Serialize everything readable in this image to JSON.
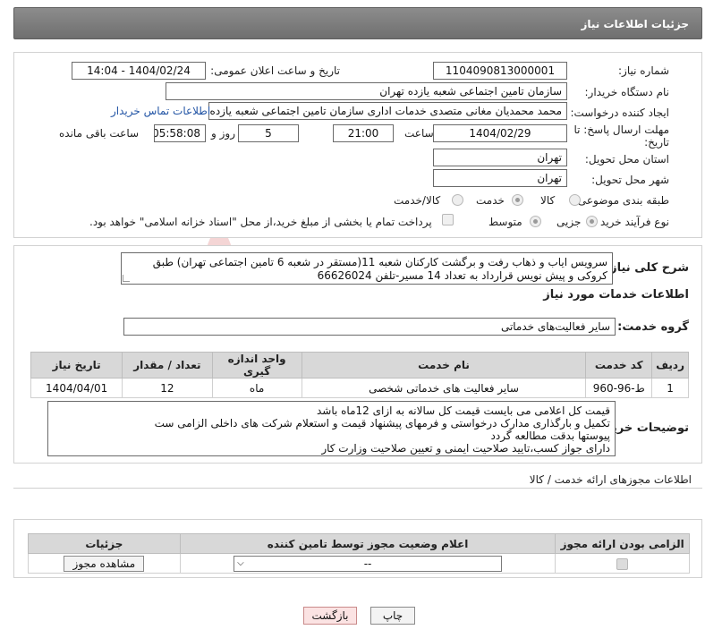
{
  "header": {
    "title": "جزئیات اطلاعات نیاز"
  },
  "form": {
    "need_number_label": "شماره نیاز:",
    "need_number": "1104090813000001",
    "announce_label": "تاریخ و ساعت اعلان عمومی:",
    "announce_value": "1404/02/24 - 14:04",
    "buyer_org_label": "نام دستگاه خریدار:",
    "buyer_org": "سازمان تامین اجتماعی شعبه یازده تهران",
    "creator_label": "ایجاد کننده درخواست:",
    "creator": "محمد محمدیان مغانی متصدی خدمات اداری سازمان تامین اجتماعی شعبه یازده",
    "contact_link": "اطلاعات تماس خریدار",
    "deadline_label": "مهلت ارسال پاسخ: تا تاریخ:",
    "deadline_date": "1404/02/29",
    "time_label": "ساعت",
    "deadline_time": "21:00",
    "days_value": "5",
    "days_label": "روز و",
    "remaining_time": "05:58:08",
    "remaining_label": "ساعت باقی مانده",
    "province_label": "استان محل تحویل:",
    "province": "تهران",
    "city_label": "شهر محل تحویل:",
    "city": "تهران",
    "category_label": "طبقه بندی موضوعی:",
    "category_options": [
      "کالا",
      "خدمت",
      "کالا/خدمت"
    ],
    "category_selected": "خدمت",
    "purchase_type_label": "نوع فرآیند خرید :",
    "purchase_options": [
      "جزیی",
      "متوسط"
    ],
    "purchase_selected": "جزیی",
    "treasury_note": "پرداخت تمام یا بخشی از مبلغ خرید،از محل \"اسناد خزانه اسلامی\" خواهد بود."
  },
  "description": {
    "label": "شرح کلی نیاز:",
    "text": "سرویس ایاب و ذهاب رفت و برگشت کارکنان شعبه 11(مستقر در شعبه 6 تامین اجتماعی تهران) طبق کروکی و پیش نویس قرارداد به تعداد 14 مسیر-تلفن 66626024"
  },
  "services": {
    "section_title": "اطلاعات خدمات مورد نیاز",
    "group_label": "گروه خدمت:",
    "group_value": "سایر فعالیت‌های خدماتی",
    "columns": [
      "ردیف",
      "کد خدمت",
      "نام خدمت",
      "واحد اندازه گیری",
      "تعداد / مقدار",
      "تاریخ نیاز"
    ],
    "rows": [
      [
        "1",
        "ط-96-960",
        "سایر فعالیت های خدماتی شخصی",
        "ماه",
        "12",
        "1404/04/01"
      ]
    ]
  },
  "buyer_notes": {
    "label": "توضیحات خریدار:",
    "lines": [
      "قیمت کل اعلامی می بایست قیمت کل سالانه به ازای 12ماه باشد",
      "تکمیل و بارگذاری مدارک درخواستی و فرمهای پیشنهاد قیمت و استعلام شرکت های داخلی الزامی ست",
      "پیوستها بدقت مطالعه گردد",
      "دارای جواز کسب،تایید صلاحیت ایمنی و تعیین صلاحیت وزارت کار"
    ]
  },
  "permits": {
    "section_title": "اطلاعات مجوزهای ارائه خدمت / کالا",
    "columns": [
      "الزامی بودن ارائه مجوز",
      "اعلام وضعیت مجوز توسط تامین کننده",
      "جزئیات"
    ],
    "status_value": "--",
    "view_button": "مشاهده مجوز"
  },
  "footer": {
    "print_button": "چاپ",
    "back_button": "بازگشت"
  },
  "watermark_text": "AriaTender.neT",
  "colors": {
    "header_bg": "#7d7d7d",
    "link": "#2355a5",
    "back_button_bg": "#fbe3e3"
  }
}
